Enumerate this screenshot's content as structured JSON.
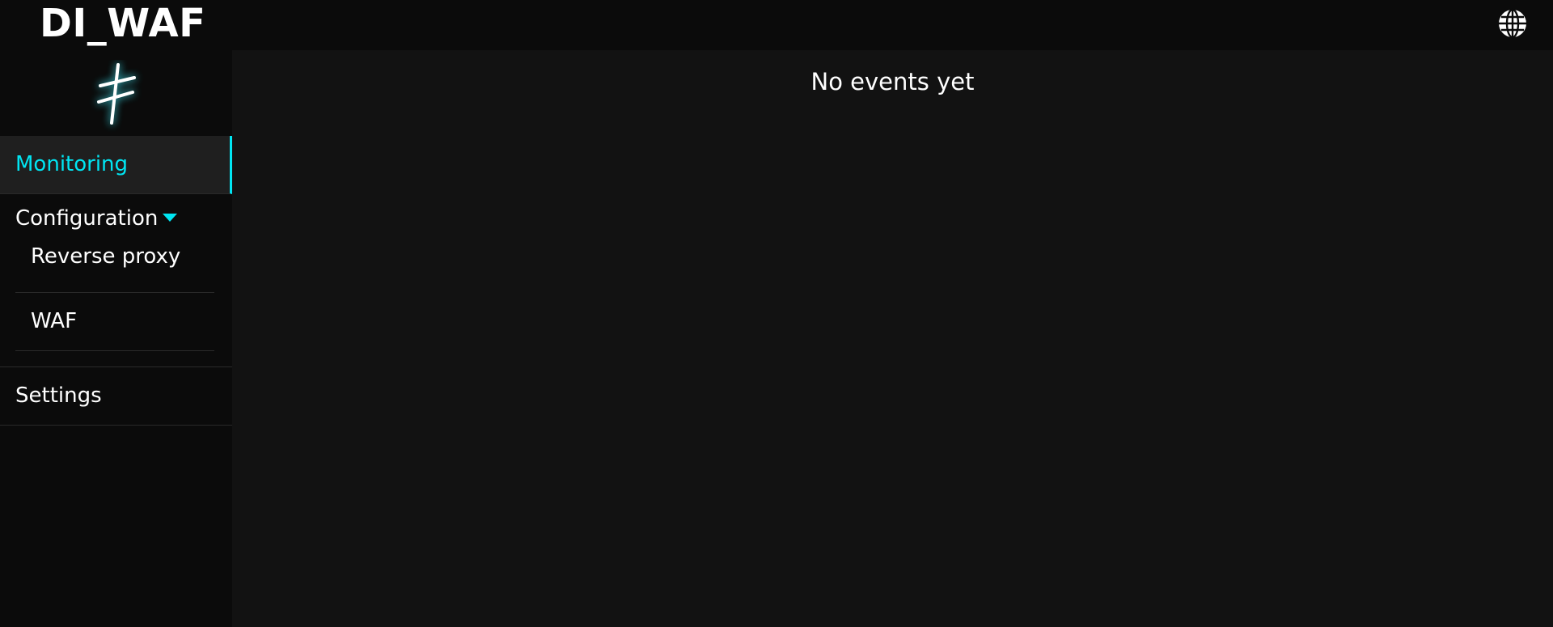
{
  "app": {
    "brand": "DI_WAF",
    "lang_icon": "globe-icon",
    "logo": "glowing-slash-rune-logo",
    "accent_color": "#00e5f2"
  },
  "sidebar": {
    "monitoring": "Monitoring",
    "configuration": "Configuration",
    "configuration_items": [
      "Reverse proxy",
      "WAF"
    ],
    "settings": "Settings"
  },
  "main": {
    "empty_message": "No events yet"
  }
}
